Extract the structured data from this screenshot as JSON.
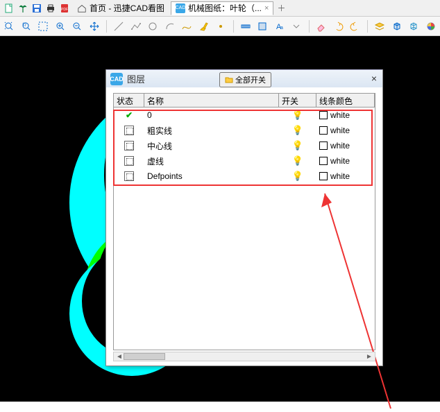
{
  "tabs": {
    "home": {
      "label": "首页 - 迅捷CAD看图"
    },
    "doc": {
      "label": "机械图纸：叶轮（... "
    }
  },
  "dialog": {
    "title": "图层",
    "toggle_all": "全部开关",
    "headers": {
      "state": "状态",
      "name": "名称",
      "switch": "开关",
      "color": "线条颜色"
    },
    "rows": [
      {
        "name": "0",
        "color": "white",
        "checked": true
      },
      {
        "name": "粗实线",
        "color": "white",
        "checked": false
      },
      {
        "name": "中心线",
        "color": "white",
        "checked": false
      },
      {
        "name": "虚线",
        "color": "white",
        "checked": false
      },
      {
        "name": "Defpoints",
        "color": "white",
        "checked": false
      }
    ]
  }
}
